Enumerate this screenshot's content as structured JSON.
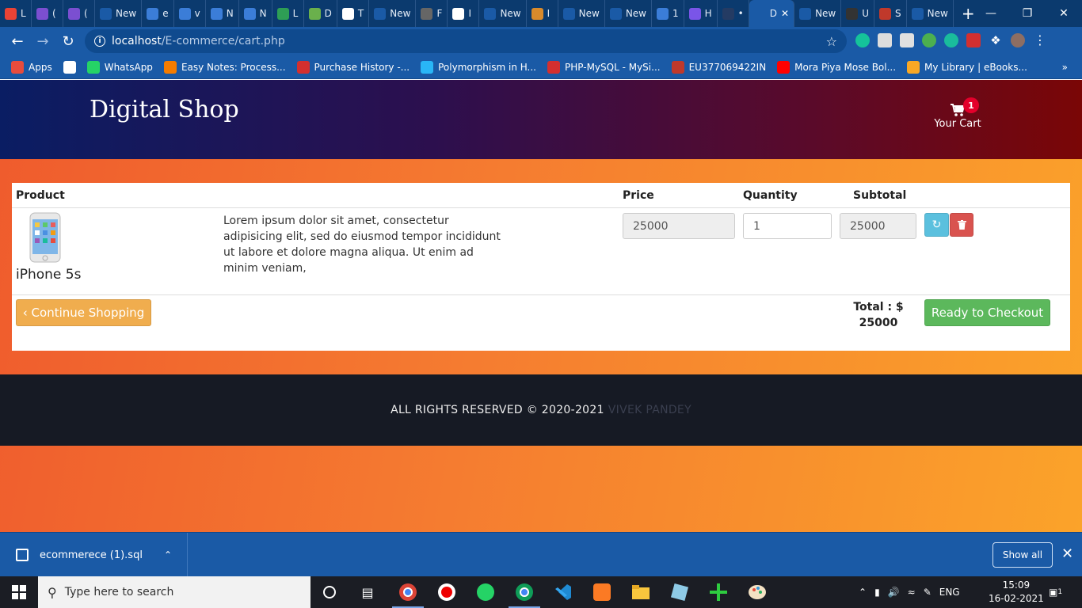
{
  "browser": {
    "tabs": [
      {
        "label": "L",
        "color": "#ea4335"
      },
      {
        "label": "(",
        "color": "#7b4fd1"
      },
      {
        "label": "(",
        "color": "#7b4fd1"
      },
      {
        "label": "New",
        "color": "#1a5aa6"
      },
      {
        "label": "e",
        "color": "#3b7dd8"
      },
      {
        "label": "v",
        "color": "#3b7dd8"
      },
      {
        "label": "N",
        "color": "#3b7dd8"
      },
      {
        "label": "N",
        "color": "#3b7dd8"
      },
      {
        "label": "L",
        "color": "#2e9e55"
      },
      {
        "label": "D",
        "color": "#6ab04c"
      },
      {
        "label": "T",
        "color": "#ffffff"
      },
      {
        "label": "New",
        "color": "#1a5aa6"
      },
      {
        "label": "F",
        "color": "#666666"
      },
      {
        "label": "I",
        "color": "#ffffff"
      },
      {
        "label": "New",
        "color": "#1a5aa6"
      },
      {
        "label": "I",
        "color": "#d98a2b"
      },
      {
        "label": "New",
        "color": "#1a5aa6"
      },
      {
        "label": "New",
        "color": "#1a5aa6"
      },
      {
        "label": "1",
        "color": "#3b7dd8"
      },
      {
        "label": "H",
        "color": "#7a55e8"
      },
      {
        "label": "•",
        "color": "#243b63"
      },
      {
        "label": "D",
        "color": "#1a5aa6",
        "active": true
      },
      {
        "label": "New",
        "color": "#1a5aa6"
      },
      {
        "label": "U",
        "color": "#333333"
      },
      {
        "label": "S",
        "color": "#c0392b"
      },
      {
        "label": "New",
        "color": "#1a5aa6"
      }
    ],
    "new_tab": "+",
    "address": {
      "host": "localhost",
      "path": "/E-commerce/cart.php"
    },
    "bookmarks": [
      {
        "label": "Apps",
        "color": "#e84c3d"
      },
      {
        "label": "",
        "color": "#ffffff"
      },
      {
        "label": "WhatsApp",
        "color": "#25d366"
      },
      {
        "label": "Easy Notes: Process...",
        "color": "#f57c00"
      },
      {
        "label": "Purchase History -...",
        "color": "#d32f2f"
      },
      {
        "label": "Polymorphism in H...",
        "color": "#29b6f6"
      },
      {
        "label": "PHP-MySQL - MySi...",
        "color": "#d32f2f"
      },
      {
        "label": "EU377069422IN",
        "color": "#c0392b"
      },
      {
        "label": "Mora Piya Mose Bol...",
        "color": "#ff0000"
      },
      {
        "label": "My Library | eBooks...",
        "color": "#f9a825"
      }
    ],
    "bookmarks_more": "»"
  },
  "site": {
    "brand": "Digital Shop",
    "cart": {
      "label": "Your Cart",
      "count": "1"
    },
    "table": {
      "headers": {
        "product": "Product",
        "price": "Price",
        "quantity": "Quantity",
        "subtotal": "Subtotal"
      },
      "row": {
        "name": "iPhone 5s",
        "description": "Lorem ipsum dolor sit amet, consectetur adipisicing elit, sed do eiusmod tempor incididunt ut labore et dolore magna aliqua. Ut enim ad minim veniam,",
        "price": "25000",
        "quantity": "1",
        "subtotal": "25000"
      }
    },
    "continue_label": "‹ Continue Shopping",
    "total_label": "Total : $",
    "total_value": "25000",
    "checkout_label": "Ready to Checkout",
    "footer": {
      "text": "ALL RIGHTS RESERVED © 2020-2021",
      "author": "VIVEK PANDEY"
    }
  },
  "downloads": {
    "file": "ecommerece (1).sql",
    "show_all": "Show all"
  },
  "taskbar": {
    "search_placeholder": "Type here to search",
    "language": "ENG",
    "time": "15:09",
    "date": "16-02-2021",
    "notifications": "1"
  }
}
